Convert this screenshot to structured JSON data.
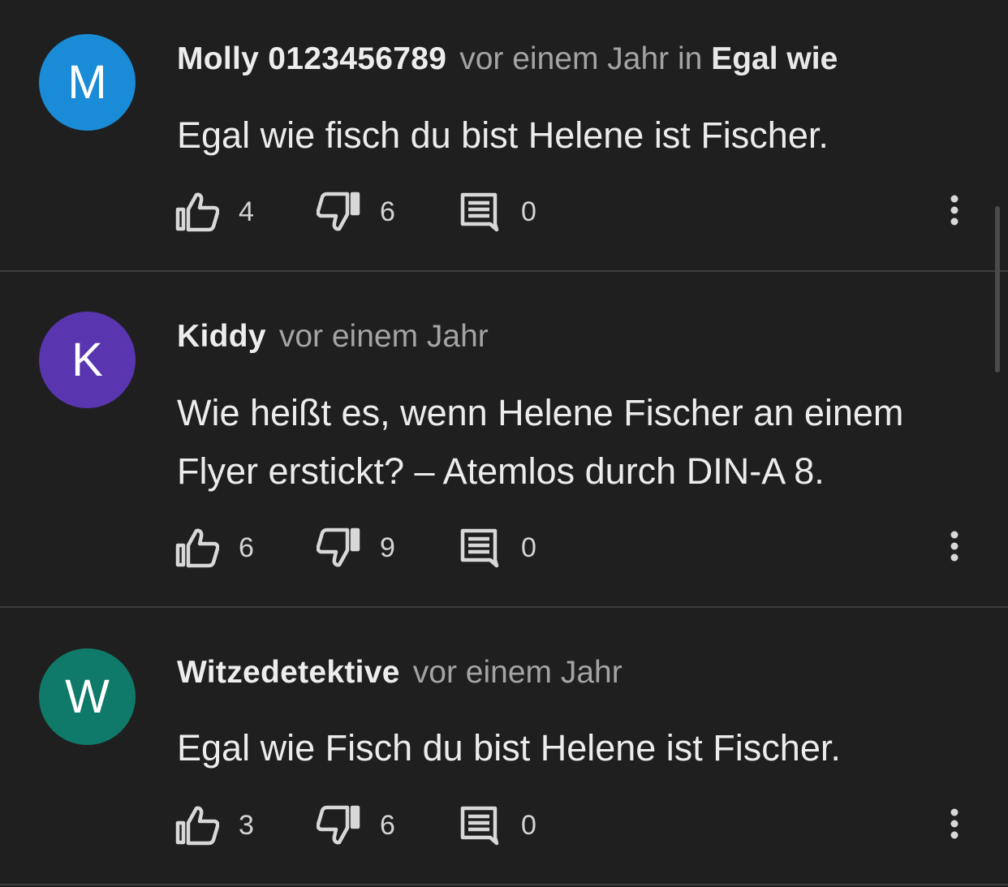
{
  "colors": {
    "background": "#1f1f1f",
    "divider": "#3e3e3e",
    "avatar_m": "#1a8bd6",
    "avatar_k": "#5a35b0",
    "avatar_w": "#107a6a"
  },
  "icons": {
    "like": "thumb-up-icon",
    "dislike": "thumb-down-icon",
    "reply": "comment-icon",
    "more": "more-vertical-icon"
  },
  "comments": [
    {
      "avatar_letter": "M",
      "author": "Molly 0123456789",
      "time": "vor einem Jahr in",
      "in_link": "Egal wie",
      "text": "Egal wie fisch du bist Helene ist Fischer.",
      "likes": "4",
      "dislikes": "6",
      "replies": "0"
    },
    {
      "avatar_letter": "K",
      "author": "Kiddy",
      "time": "vor einem Jahr",
      "text": "Wie heißt es, wenn Helene Fischer an einem Flyer erstickt? – Atemlos durch DIN-A 8.",
      "likes": "6",
      "dislikes": "9",
      "replies": "0"
    },
    {
      "avatar_letter": "W",
      "author": "Witzedetektive",
      "time": "vor einem Jahr",
      "text": "Egal wie Fisch du bist Helene ist Fischer.",
      "likes": "3",
      "dislikes": "6",
      "replies": "0"
    }
  ]
}
